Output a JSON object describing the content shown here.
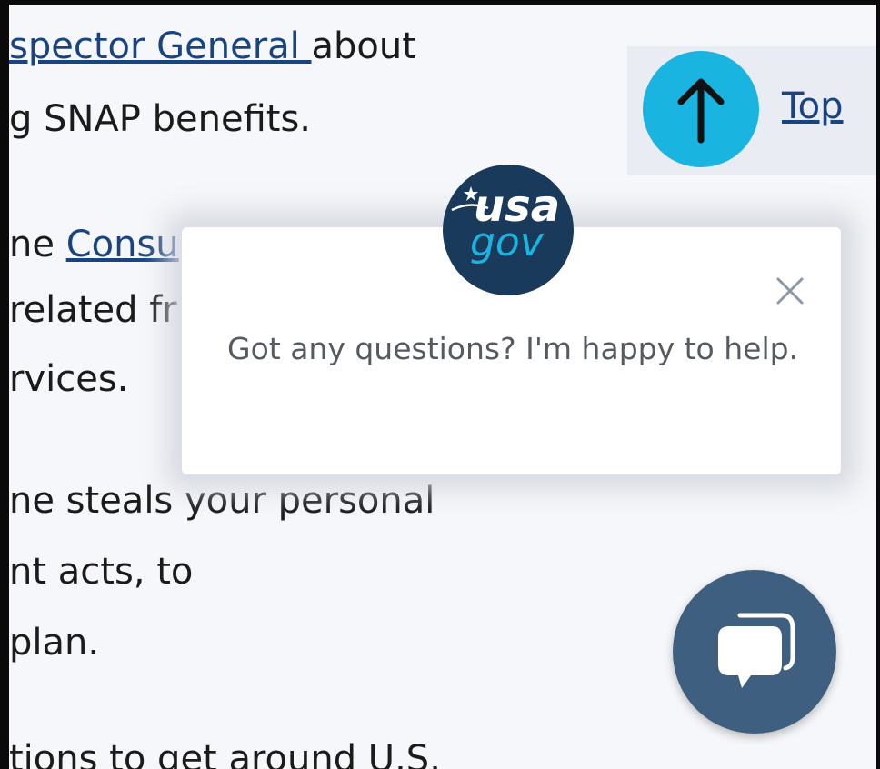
{
  "article": {
    "line1_link": "spector General ",
    "line1_text": "about",
    "line2": "g SNAP benefits.",
    "line3_prefix": "ne ",
    "line3_link": "Consu",
    "line4": "related fr",
    "line5": "rvices.",
    "line6": "ne steals your personal",
    "line7": "nt acts, to",
    "line8": "plan.",
    "line9": "tions to get around U.S."
  },
  "back_to_top": {
    "label": "Top",
    "icon": "arrow-up-icon"
  },
  "chat": {
    "logo_text_top": "usa",
    "logo_text_bottom": "gov",
    "message": "Got any questions? I'm happy to help.",
    "close_icon": "close-icon",
    "launcher_icon": "chat-bubble-icon"
  },
  "colors": {
    "link": "#1a4480",
    "top_button": "#1ab4e0",
    "logo_bg": "#1a3a5c",
    "logo_accent": "#1ab4e0",
    "chat_fab": "#3e5f80"
  }
}
